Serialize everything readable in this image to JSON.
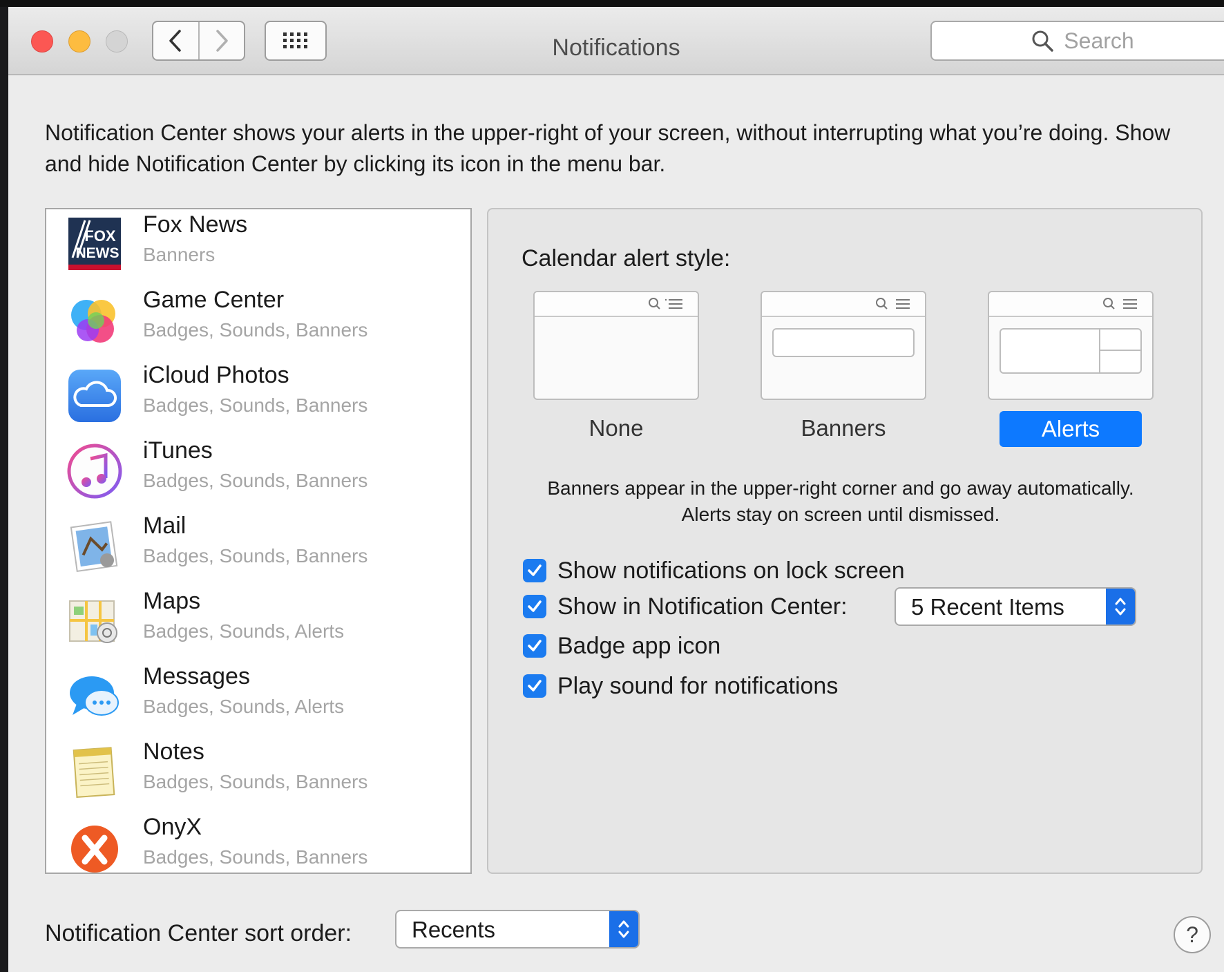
{
  "window": {
    "title": "Notifications",
    "search_placeholder": "Search"
  },
  "intro_text": "Notification Center shows your alerts in the upper-right of your screen, without interrupting what you’re doing. Show and hide Notification Center by clicking its icon in the menu bar.",
  "apps": [
    {
      "name": "Fox News",
      "style": "Banners",
      "icon": "fox-news-icon"
    },
    {
      "name": "Game Center",
      "style": "Badges, Sounds, Banners",
      "icon": "game-center-icon"
    },
    {
      "name": "iCloud Photos",
      "style": "Badges, Sounds, Banners",
      "icon": "icloud-photos-icon"
    },
    {
      "name": "iTunes",
      "style": "Badges, Sounds, Banners",
      "icon": "itunes-icon"
    },
    {
      "name": "Mail",
      "style": "Badges, Sounds, Banners",
      "icon": "mail-icon"
    },
    {
      "name": "Maps",
      "style": "Badges, Sounds, Alerts",
      "icon": "maps-icon"
    },
    {
      "name": "Messages",
      "style": "Badges, Sounds, Alerts",
      "icon": "messages-icon"
    },
    {
      "name": "Notes",
      "style": "Badges, Sounds, Banners",
      "icon": "notes-icon"
    },
    {
      "name": "OnyX",
      "style": "Badges, Sounds, Banners",
      "icon": "onyx-icon"
    }
  ],
  "fox_icon_text": {
    "line1": "FOX",
    "line2": "NEWS"
  },
  "detail": {
    "heading": "Calendar alert style:",
    "styles": [
      {
        "label": "None",
        "selected": false
      },
      {
        "label": "Banners",
        "selected": false
      },
      {
        "label": "Alerts",
        "selected": true
      }
    ],
    "description": "Banners appear in the upper-right corner and go away automatically. Alerts stay on screen until dismissed.",
    "options": [
      {
        "label": "Show notifications on lock screen",
        "checked": true
      },
      {
        "label": "Show in Notification Center:",
        "checked": true
      },
      {
        "label": "Badge app icon",
        "checked": true
      },
      {
        "label": "Play sound for notifications",
        "checked": true
      }
    ],
    "recent_items_value": "5 Recent Items"
  },
  "sort": {
    "label": "Notification Center sort order:",
    "value": "Recents"
  },
  "help_glyph": "?",
  "colors": {
    "accent": "#0d79ff",
    "close": "#fc5753",
    "minimize": "#fdbc40"
  }
}
